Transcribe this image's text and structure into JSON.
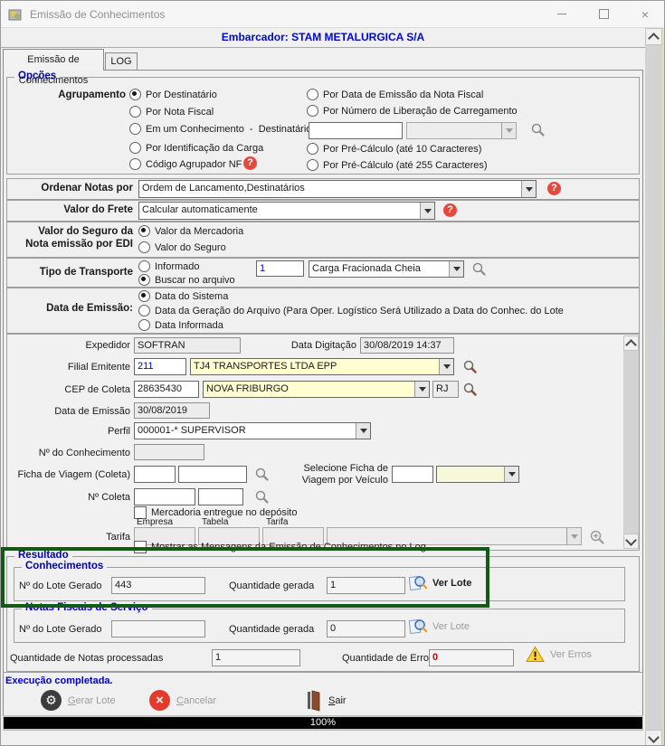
{
  "window": {
    "title": "Emissão de Conhecimentos"
  },
  "header": {
    "embarcador": "Embarcador: STAM METALURGICA S/A"
  },
  "tabs": [
    {
      "label": "Emissão de Conhecimentos"
    },
    {
      "label": "LOG"
    }
  ],
  "icons": {
    "help_glyph": "?",
    "cancel_glyph": "×",
    "gear_glyph": "⚙",
    "close_glyph": "×"
  },
  "opcoes": {
    "legend": "Opções",
    "agrupamento_label": "Agrupamento",
    "col1": [
      {
        "label": "Por Destinatário"
      },
      {
        "label": "Por Nota Fiscal"
      },
      {
        "label": "Em um Conhecimento  -  Destinatário"
      },
      {
        "label": "Por Identificação da Carga"
      },
      {
        "label": "Código Agrupador NF"
      }
    ],
    "col2": [
      {
        "label": "Por Data de Emissão da Nota Fiscal"
      },
      {
        "label": "Por Número de Liberação de Carregamento"
      },
      {
        "label": "Por Pré-Cálculo (até 10 Caracteres)"
      },
      {
        "label": "Por Pré-Cálculo (até 255 Caracteres)"
      }
    ],
    "liberacao_input": "",
    "liberacao_select": ""
  },
  "ordenar": {
    "label": "Ordenar Notas por",
    "value": "Ordem de Lancamento,Destinatários"
  },
  "frete": {
    "label": "Valor do Frete",
    "value": "Calcular automaticamente"
  },
  "seguro": {
    "label_line1": "Valor do Seguro da",
    "label_line2": "Nota emissão por EDI",
    "opt1": "Valor da Mercadoria",
    "opt2": "Valor do Seguro"
  },
  "transporte": {
    "label": "Tipo de Transporte",
    "opt1": "Informado",
    "opt2": "Buscar no arquivo",
    "codigo": "1",
    "tipo": "Carga Fracionada Cheia"
  },
  "emissao": {
    "label": "Data de Emissão:",
    "opt1": "Data do Sistema",
    "opt2": "Data da Geração do Arquivo (Para Oper. Logístico Será Utilizado a Data do Conhec. do Lote",
    "opt3": "Data Informada"
  },
  "detalhes": {
    "expedidor_label": "Expedidor",
    "expedidor": "SOFTRAN",
    "digitacao_label": "Data Digitação",
    "digitacao": "30/08/2019 14:37",
    "filial_label": "Filial Emitente",
    "filial_codigo": "211",
    "filial_nome": "TJ4 TRANSPORTES LTDA EPP",
    "cep_label": "CEP de Coleta",
    "cep": "28635430",
    "cidade": "NOVA FRIBURGO",
    "uf": "RJ",
    "data_emissao_label": "Data de Emissão",
    "data_emissao": "30/08/2019",
    "perfil_label": "Perfil",
    "perfil": "000001-* SUPERVISOR",
    "conhecimento_label": "Nº do Conhecimento",
    "conhecimento": "",
    "ficha_label": "Ficha de Viagem (Coleta)",
    "ficha1": "",
    "ficha2": "",
    "selecione_label_line1": "Selecione Ficha de",
    "selecione_label_line2": "Viagem por Veículo",
    "veiculo": "",
    "veiculo_ficha": "",
    "coleta_label": "Nº Coleta",
    "coleta1": "",
    "coleta2": "",
    "mercadoria_checkbox": "Mercadoria entregue no depósito",
    "tarifa_headers": [
      "Empresa",
      "Tabela",
      "Tarifa"
    ],
    "tarifa_label": "Tarifa",
    "tarifa_empresa": "",
    "tarifa_tabela": "",
    "tarifa_tarifa": "",
    "tarifa_descricao": "",
    "mostrar_checkbox": "Mostrar as Mensagens da Emissão de Conhecimentos no Log"
  },
  "resultado": {
    "legend": "Resultado",
    "conhecimentos": {
      "legend": "Conhecimentos",
      "lote_label": "Nº do Lote Gerado",
      "lote": "443",
      "qtd_label": "Quantidade gerada",
      "qtd": "1",
      "ver_lote": "Ver Lote"
    },
    "nfs": {
      "legend": "Notas Fiscais de Serviço",
      "lote_label": "Nº do Lote Gerado",
      "lote": "",
      "qtd_label": "Quantidade gerada",
      "qtd": "0",
      "ver_lote": "Ver Lote"
    },
    "processadas_label": "Quantidade de Notas processadas",
    "processadas": "1",
    "erros_label": "Quantidade de Erros",
    "erros": "0",
    "ver_erros": "Ver Erros"
  },
  "status_message": "Execução completada.",
  "buttons": {
    "gerar": "Gerar Lote",
    "cancelar": "Cancelar",
    "sair": "Sair"
  },
  "progress": {
    "percent": "100%"
  },
  "colors": {
    "accent_blue": "#0000cc",
    "group_title": "#0000b4",
    "error_red": "#cc0000",
    "annotation_green": "#145a14",
    "input_yellow": "#ffffd2"
  }
}
